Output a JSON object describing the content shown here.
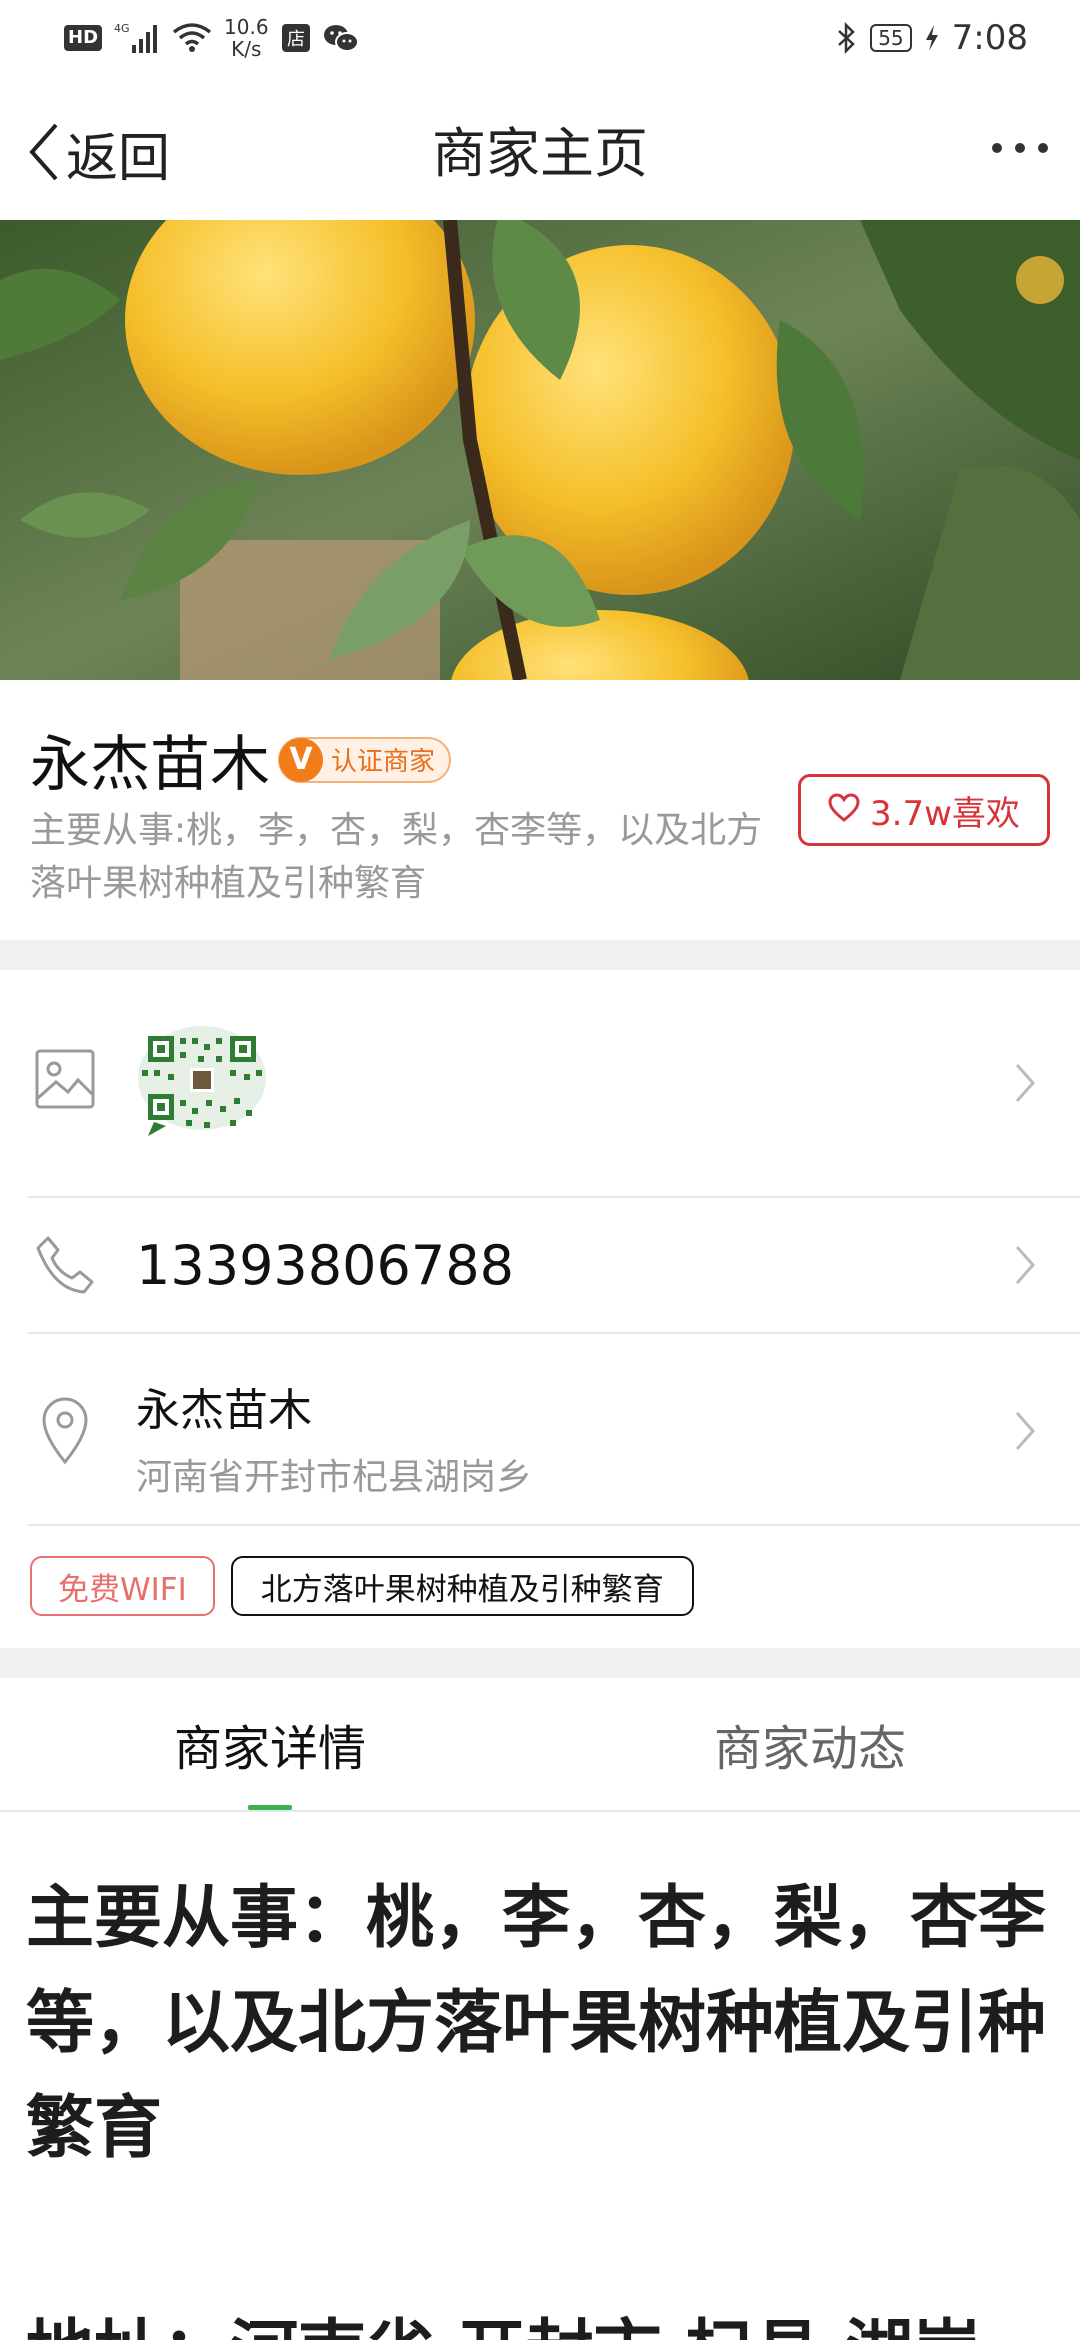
{
  "status_bar": {
    "hd": "HD",
    "network": "4G",
    "speed_value": "10.6",
    "speed_unit": "K/s",
    "store_icon": "store-icon",
    "battery": "55",
    "time": "7:08"
  },
  "nav": {
    "back_label": "返回",
    "title": "商家主页"
  },
  "merchant": {
    "name": "永杰苗木",
    "cert_mark": "V",
    "cert_label": "认证商家",
    "description": "主要从事:桃，李，杏，梨，杏李等，以及北方落叶果树种植及引种繁育",
    "likes": "3.7w喜欢"
  },
  "contact": {
    "phone": "13393806788",
    "address_name": "永杰苗木",
    "address_detail": "河南省开封市杞县湖岗乡"
  },
  "tags": [
    "免费WIFI",
    "北方落叶果树种植及引种繁育"
  ],
  "tabs": {
    "details": "商家详情",
    "updates": "商家动态"
  },
  "details": {
    "main_business": "主要从事：桃，李，杏，梨，杏李等，以及北方落叶果树种植及引种繁育",
    "address_partial": "地址：河南省 开封市 杞县 湖岗"
  },
  "colors": {
    "accent_red": "#d7343a",
    "cert_orange": "#f07c1a",
    "tab_indicator_green": "#3bb155"
  }
}
